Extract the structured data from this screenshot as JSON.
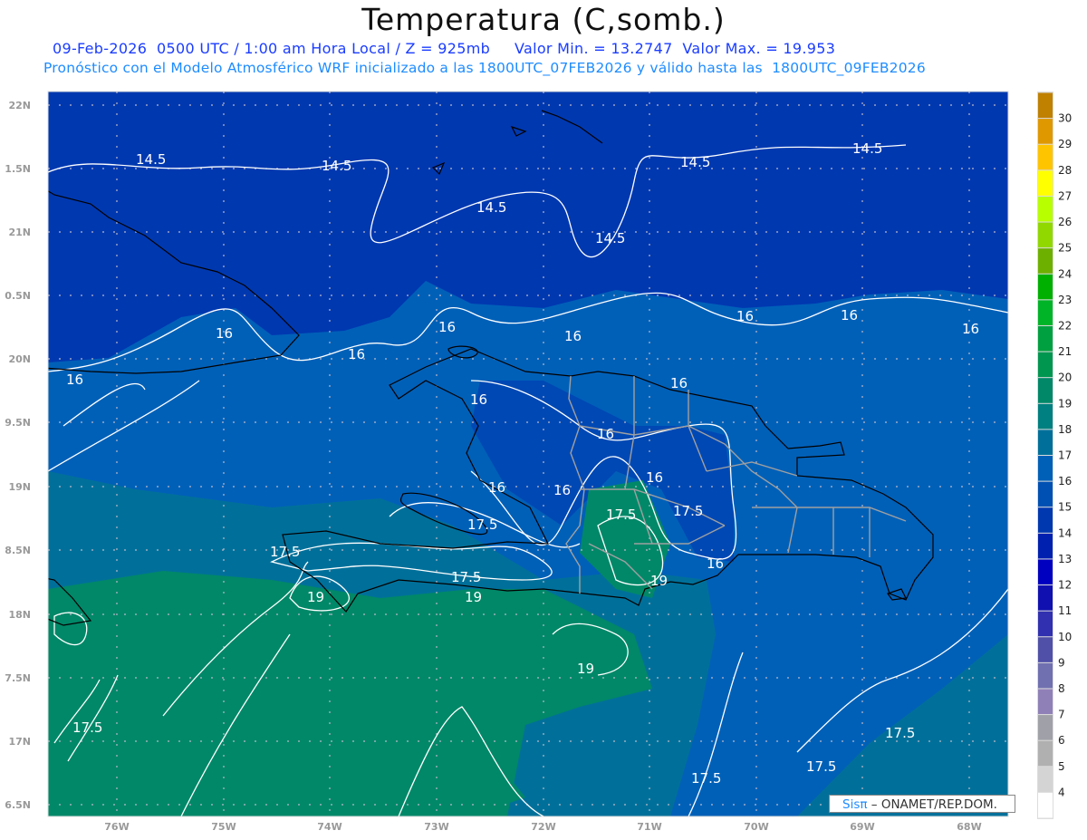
{
  "header": {
    "title": "Temperatura (C,somb.)",
    "line1": "09-Feb-2026  0500 UTC / 1:00 am Hora Local / Z = 925mb     Valor Min. = 13.2747  Valor Max. = 19.953",
    "line2": "Pronóstico con el Modelo Atmosférico WRF inicializado a las 1800UTC_07FEB2026 y válido hasta las  1800UTC_09FEB2026"
  },
  "map": {
    "variable": "Temperatura",
    "units": "C",
    "level": "925mb",
    "valid_time": "09-Feb-2026 0500 UTC",
    "value_min": 13.2747,
    "value_max": 19.953,
    "lon_ticks": [
      "76W",
      "75W",
      "74W",
      "73W",
      "72W",
      "71W",
      "70W",
      "69W",
      "68W"
    ],
    "lat_ticks": [
      "22N",
      "1.5N",
      "21N",
      "0.5N",
      "20N",
      "9.5N",
      "19N",
      "8.5N",
      "18N",
      "7.5N",
      "17N",
      "6.5N"
    ],
    "contour_labels": {
      "c145": [
        "14.5",
        "14.5",
        "14.5",
        "14.5",
        "14.5",
        "14.5"
      ],
      "c16": [
        "16",
        "16",
        "16",
        "16",
        "16",
        "16",
        "16",
        "16",
        "16",
        "16",
        "16",
        "16",
        "16",
        "16",
        "16"
      ],
      "c175": [
        "17.5",
        "17.5",
        "17.5",
        "17.5",
        "17.5",
        "17.5",
        "17.5",
        "17.5",
        "17.5"
      ],
      "c19": [
        "19",
        "19",
        "19",
        "19"
      ]
    },
    "fill_colors": {
      "t14": "#0038b0",
      "t15": "#0050b4",
      "t16": "#0060b8",
      "t17": "#00709a",
      "t18": "#008080",
      "t19": "#008868"
    },
    "contour_color": "#ffffff",
    "coast_color": "#000000",
    "border_color": "#a0a0a0"
  },
  "colorbar": {
    "labels": [
      "30",
      "29",
      "28",
      "27",
      "26",
      "25",
      "24",
      "23",
      "22",
      "21",
      "20",
      "19",
      "18",
      "17",
      "16",
      "15",
      "14",
      "13",
      "12",
      "11",
      "10",
      "9",
      "8",
      "7",
      "6",
      "5",
      "4"
    ],
    "colors": [
      "#c08000",
      "#e09800",
      "#ffc400",
      "#ffff00",
      "#b8ff00",
      "#90d800",
      "#6eb000",
      "#00b000",
      "#00b428",
      "#00a040",
      "#009650",
      "#008868",
      "#008080",
      "#00709a",
      "#0060b8",
      "#0050b4",
      "#0038b0",
      "#0020b0",
      "#0000c0",
      "#1010b0",
      "#3030b0",
      "#5050a8",
      "#7070b0",
      "#9080b8",
      "#a0a0a8",
      "#b0b0b0",
      "#d4d4d4",
      "#ffffff"
    ]
  },
  "credit": {
    "brand": "Sisπ",
    "text": " – ONAMET/REP.DOM."
  }
}
